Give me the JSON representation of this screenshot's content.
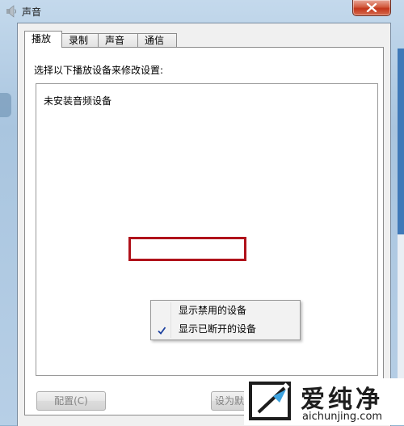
{
  "window": {
    "title": "声音",
    "close_icon": "close-icon"
  },
  "tabs": [
    {
      "label": "播放",
      "active": true
    },
    {
      "label": "录制",
      "active": false
    },
    {
      "label": "声音",
      "active": false
    },
    {
      "label": "通信",
      "active": false
    }
  ],
  "playback": {
    "instruction": "选择以下播放设备来修改设置:",
    "empty_message": "未安装音频设备"
  },
  "context_menu": {
    "items": [
      {
        "label": "显示禁用的设备",
        "checked": false,
        "highlighted": true
      },
      {
        "label": "显示已断开的设备",
        "checked": true
      }
    ]
  },
  "buttons": {
    "configure": "配置(C)",
    "set_default": "设为默"
  },
  "watermark": {
    "brand": "爱纯净",
    "url": "aichunjing.com"
  },
  "colors": {
    "highlight_box": "#b0121b",
    "close_button": "#c3361b",
    "check": "#1a3e9e"
  }
}
